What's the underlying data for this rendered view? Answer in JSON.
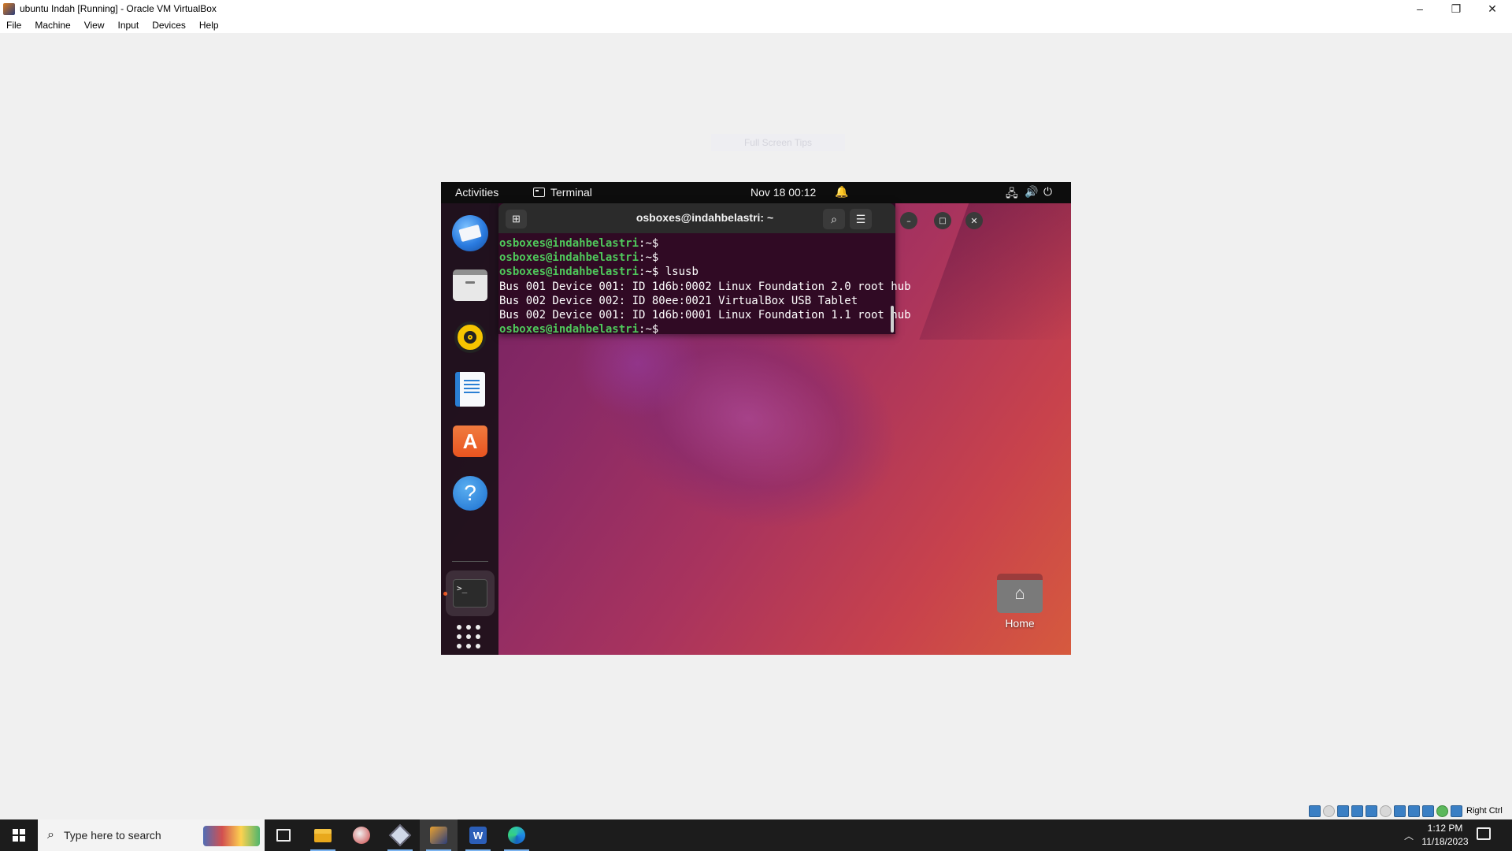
{
  "window": {
    "title": "ubuntu Indah [Running] - Oracle VM VirtualBox",
    "controls": {
      "minimize": "–",
      "restore": "❐",
      "close": "✕"
    }
  },
  "menubar": [
    "File",
    "Machine",
    "View",
    "Input",
    "Devices",
    "Help"
  ],
  "fullscreen_hint": "Full Screen Tips",
  "ubuntu": {
    "topbar": {
      "activities": "Activities",
      "app_name": "Terminal",
      "clock": "Nov 18  00:12",
      "icons": [
        "bell-icon",
        "network-icon",
        "volume-icon",
        "power-icon"
      ]
    },
    "dock": [
      "thunderbird-mail-icon",
      "files-icon",
      "rhythmbox-icon",
      "libreoffice-writer-icon",
      "app-center-icon",
      "help-icon",
      "terminal-icon",
      "show-apps-icon"
    ],
    "dock_labels": {
      "store": "A",
      "help": "?",
      "terminal": ">_"
    },
    "terminal": {
      "title": "osboxes@indahbelastri: ~",
      "lines": [
        {
          "user": "osboxes@indahbelastri",
          "sep": ":~$",
          "cmd": ""
        },
        {
          "user": "osboxes@indahbelastri",
          "sep": ":~$",
          "cmd": ""
        },
        {
          "user": "osboxes@indahbelastri",
          "sep": ":~$",
          "cmd": " lsusb"
        },
        {
          "text": "Bus 001 Device 001: ID 1d6b:0002 Linux Foundation 2.0 root hub"
        },
        {
          "text": "Bus 002 Device 002: ID 80ee:0021 VirtualBox USB Tablet"
        },
        {
          "text": "Bus 002 Device 001: ID 1d6b:0001 Linux Foundation 1.1 root hub"
        },
        {
          "user": "osboxes@indahbelastri",
          "sep": ":~$",
          "cmd": ""
        }
      ]
    },
    "desktop": {
      "home_label": "Home"
    }
  },
  "vbox_status": {
    "host_key": "Right Ctrl"
  },
  "taskbar": {
    "search_placeholder": "Type here to search",
    "time": "1:12 PM",
    "date": "11/18/2023"
  }
}
